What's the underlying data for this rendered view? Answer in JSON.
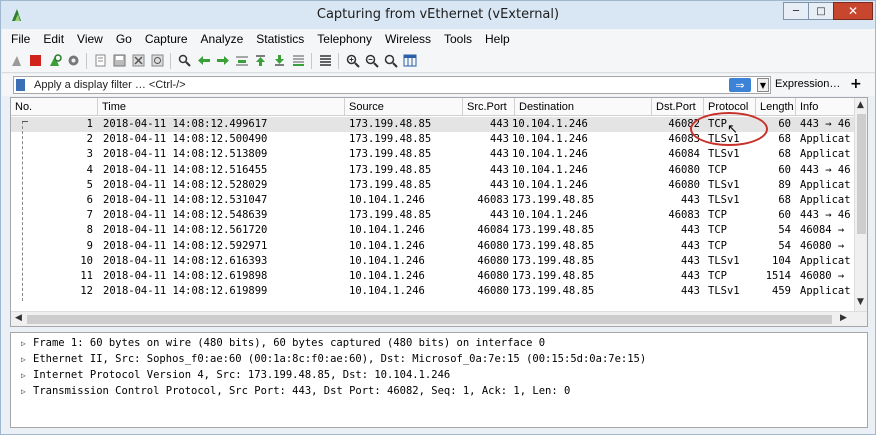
{
  "window": {
    "title": "Capturing from vEthernet (vExternal)"
  },
  "menu": [
    "File",
    "Edit",
    "View",
    "Go",
    "Capture",
    "Analyze",
    "Statistics",
    "Telephony",
    "Wireless",
    "Tools",
    "Help"
  ],
  "toolbar": {
    "icons": [
      "shark-fin-icon",
      "stop-icon",
      "restart-icon",
      "options-icon",
      "open-icon",
      "save-icon",
      "close-file-icon",
      "reload-icon",
      "find-icon",
      "back-icon",
      "forward-icon",
      "go-to-packet-icon",
      "first-packet-icon",
      "last-packet-icon",
      "autoscroll-icon",
      "colorize-icon",
      "zoom-in-icon",
      "zoom-out-icon",
      "zoom-reset-icon",
      "resize-columns-icon"
    ]
  },
  "filter": {
    "placeholder": "Apply a display filter … <Ctrl-/>",
    "apply_glyph": "⇒",
    "expression_label": "Expression…",
    "add_glyph": "+"
  },
  "columns": {
    "no": "No.",
    "time": "Time",
    "source": "Source",
    "src_port": "Src.Port",
    "destination": "Destination",
    "dst_port": "Dst.Port",
    "protocol": "Protocol",
    "length": "Length",
    "info": "Info"
  },
  "packets": [
    {
      "no": "1",
      "time": "2018-04-11 14:08:12.499617",
      "source": "173.199.48.85",
      "src_port": "443",
      "destination": "10.104.1.246",
      "dst_port": "46082",
      "protocol": "TCP",
      "length": "60",
      "info": "443 → 46"
    },
    {
      "no": "2",
      "time": "2018-04-11 14:08:12.500490",
      "source": "173.199.48.85",
      "src_port": "443",
      "destination": "10.104.1.246",
      "dst_port": "46083",
      "protocol": "TLSv1",
      "length": "68",
      "info": "Applicat"
    },
    {
      "no": "3",
      "time": "2018-04-11 14:08:12.513809",
      "source": "173.199.48.85",
      "src_port": "443",
      "destination": "10.104.1.246",
      "dst_port": "46084",
      "protocol": "TLSv1",
      "length": "68",
      "info": "Applicat"
    },
    {
      "no": "4",
      "time": "2018-04-11 14:08:12.516455",
      "source": "173.199.48.85",
      "src_port": "443",
      "destination": "10.104.1.246",
      "dst_port": "46080",
      "protocol": "TCP",
      "length": "60",
      "info": "443 → 46"
    },
    {
      "no": "5",
      "time": "2018-04-11 14:08:12.528029",
      "source": "173.199.48.85",
      "src_port": "443",
      "destination": "10.104.1.246",
      "dst_port": "46080",
      "protocol": "TLSv1",
      "length": "89",
      "info": "Applicat"
    },
    {
      "no": "6",
      "time": "2018-04-11 14:08:12.531047",
      "source": "10.104.1.246",
      "src_port": "46083",
      "destination": "173.199.48.85",
      "dst_port": "443",
      "protocol": "TLSv1",
      "length": "68",
      "info": "Applicat"
    },
    {
      "no": "7",
      "time": "2018-04-11 14:08:12.548639",
      "source": "173.199.48.85",
      "src_port": "443",
      "destination": "10.104.1.246",
      "dst_port": "46083",
      "protocol": "TCP",
      "length": "60",
      "info": "443 → 46"
    },
    {
      "no": "8",
      "time": "2018-04-11 14:08:12.561720",
      "source": "10.104.1.246",
      "src_port": "46084",
      "destination": "173.199.48.85",
      "dst_port": "443",
      "protocol": "TCP",
      "length": "54",
      "info": "46084 →"
    },
    {
      "no": "9",
      "time": "2018-04-11 14:08:12.592971",
      "source": "10.104.1.246",
      "src_port": "46080",
      "destination": "173.199.48.85",
      "dst_port": "443",
      "protocol": "TCP",
      "length": "54",
      "info": "46080 →"
    },
    {
      "no": "10",
      "time": "2018-04-11 14:08:12.616393",
      "source": "10.104.1.246",
      "src_port": "46080",
      "destination": "173.199.48.85",
      "dst_port": "443",
      "protocol": "TLSv1",
      "length": "104",
      "info": "Applicat"
    },
    {
      "no": "11",
      "time": "2018-04-11 14:08:12.619898",
      "source": "10.104.1.246",
      "src_port": "46080",
      "destination": "173.199.48.85",
      "dst_port": "443",
      "protocol": "TCP",
      "length": "1514",
      "info": "46080 →"
    },
    {
      "no": "12",
      "time": "2018-04-11 14:08:12.619899",
      "source": "10.104.1.246",
      "src_port": "46080",
      "destination": "173.199.48.85",
      "dst_port": "443",
      "protocol": "TLSv1",
      "length": "459",
      "info": "Applicat"
    }
  ],
  "details": [
    "Frame 1: 60 bytes on wire (480 bits), 60 bytes captured (480 bits) on interface 0",
    "Ethernet II, Src: Sophos_f0:ae:60 (00:1a:8c:f0:ae:60), Dst: Microsof_0a:7e:15 (00:15:5d:0a:7e:15)",
    "Internet Protocol Version 4, Src: 173.199.48.85, Dst: 10.104.1.246",
    "Transmission Control Protocol, Src Port: 443, Dst Port: 46082, Seq: 1, Ack: 1, Len: 0"
  ],
  "colors": {
    "highlight": "#c8302a",
    "selected_row": "#e4e4e4",
    "apply_button": "#3c82d7"
  }
}
